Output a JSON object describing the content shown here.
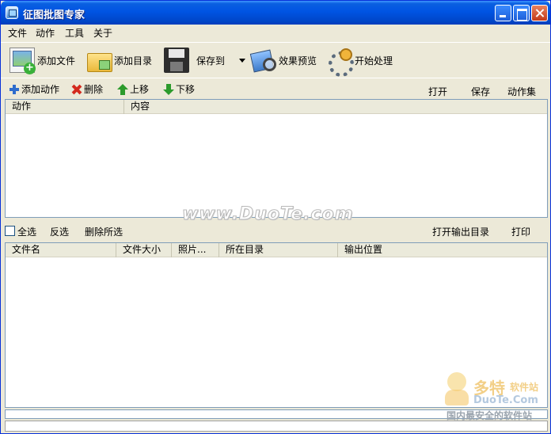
{
  "window": {
    "title": "征图批图专家"
  },
  "menu": [
    "文件",
    "动作",
    "工具",
    "关于"
  ],
  "toolbar": {
    "add_file": "添加文件",
    "add_dir": "添加目录",
    "save_to": "保存到",
    "preview": "效果预览",
    "start": "开始处理"
  },
  "actions": {
    "add": "添加动作",
    "delete": "删除",
    "up": "上移",
    "down": "下移",
    "open": "打开",
    "save": "保存",
    "action_set": "动作集"
  },
  "action_list": {
    "columns": [
      "动作",
      "内容"
    ]
  },
  "selection": {
    "select_all": "全选",
    "invert": "反选",
    "delete_selected": "删除所选",
    "open_output": "打开输出目录",
    "print": "打印"
  },
  "file_list": {
    "columns": [
      "文件名",
      "文件大小",
      "照片...",
      "所在目录",
      "输出位置"
    ]
  },
  "watermark": {
    "center": "www.DuoTe.com",
    "brand": "多特",
    "brand_sub": "软件站",
    "domain": "DuoTe.Com",
    "slogan": "国内最安全的软件站"
  }
}
